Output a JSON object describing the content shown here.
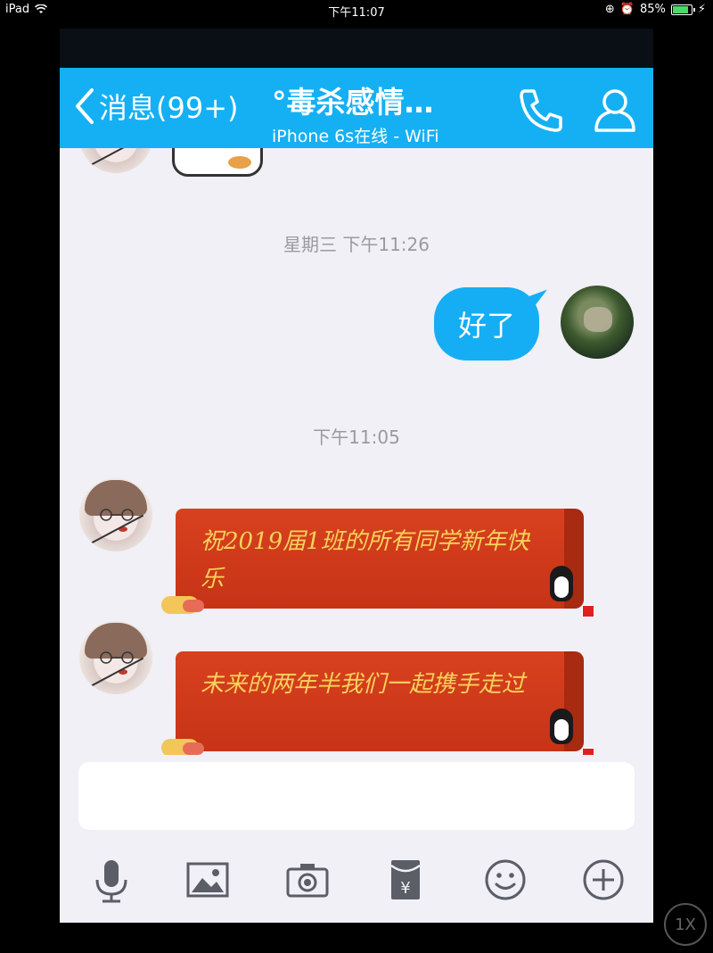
{
  "status_bar": {
    "device": "iPad",
    "time": "下午11:07",
    "battery_percent": "85%",
    "battery_level": 0.85
  },
  "nav": {
    "back_label": "消息(99+)",
    "title": "°毒杀感情…",
    "subtitle": "iPhone 6s在线 - WiFi"
  },
  "chat": {
    "timestamps": [
      "星期三 下午11:26",
      "下午11:05"
    ],
    "messages": [
      {
        "side": "right",
        "text": "好了"
      },
      {
        "side": "left",
        "text": "祝2019届1班的所有同学新年快乐"
      },
      {
        "side": "left",
        "text": "未来的两年半我们一起携手走过"
      }
    ]
  },
  "toolbar": {
    "icons": [
      "microphone-icon",
      "image-icon",
      "camera-icon",
      "red-packet-icon",
      "emoji-icon",
      "plus-icon"
    ]
  },
  "overlay": {
    "speed_label": "1X"
  },
  "colors": {
    "nav_blue": "#15b0f3",
    "bubble_blue": "#15aef5",
    "card_red": "#c63316",
    "card_text": "#f7d25a",
    "chat_bg": "#f0f0f6"
  }
}
